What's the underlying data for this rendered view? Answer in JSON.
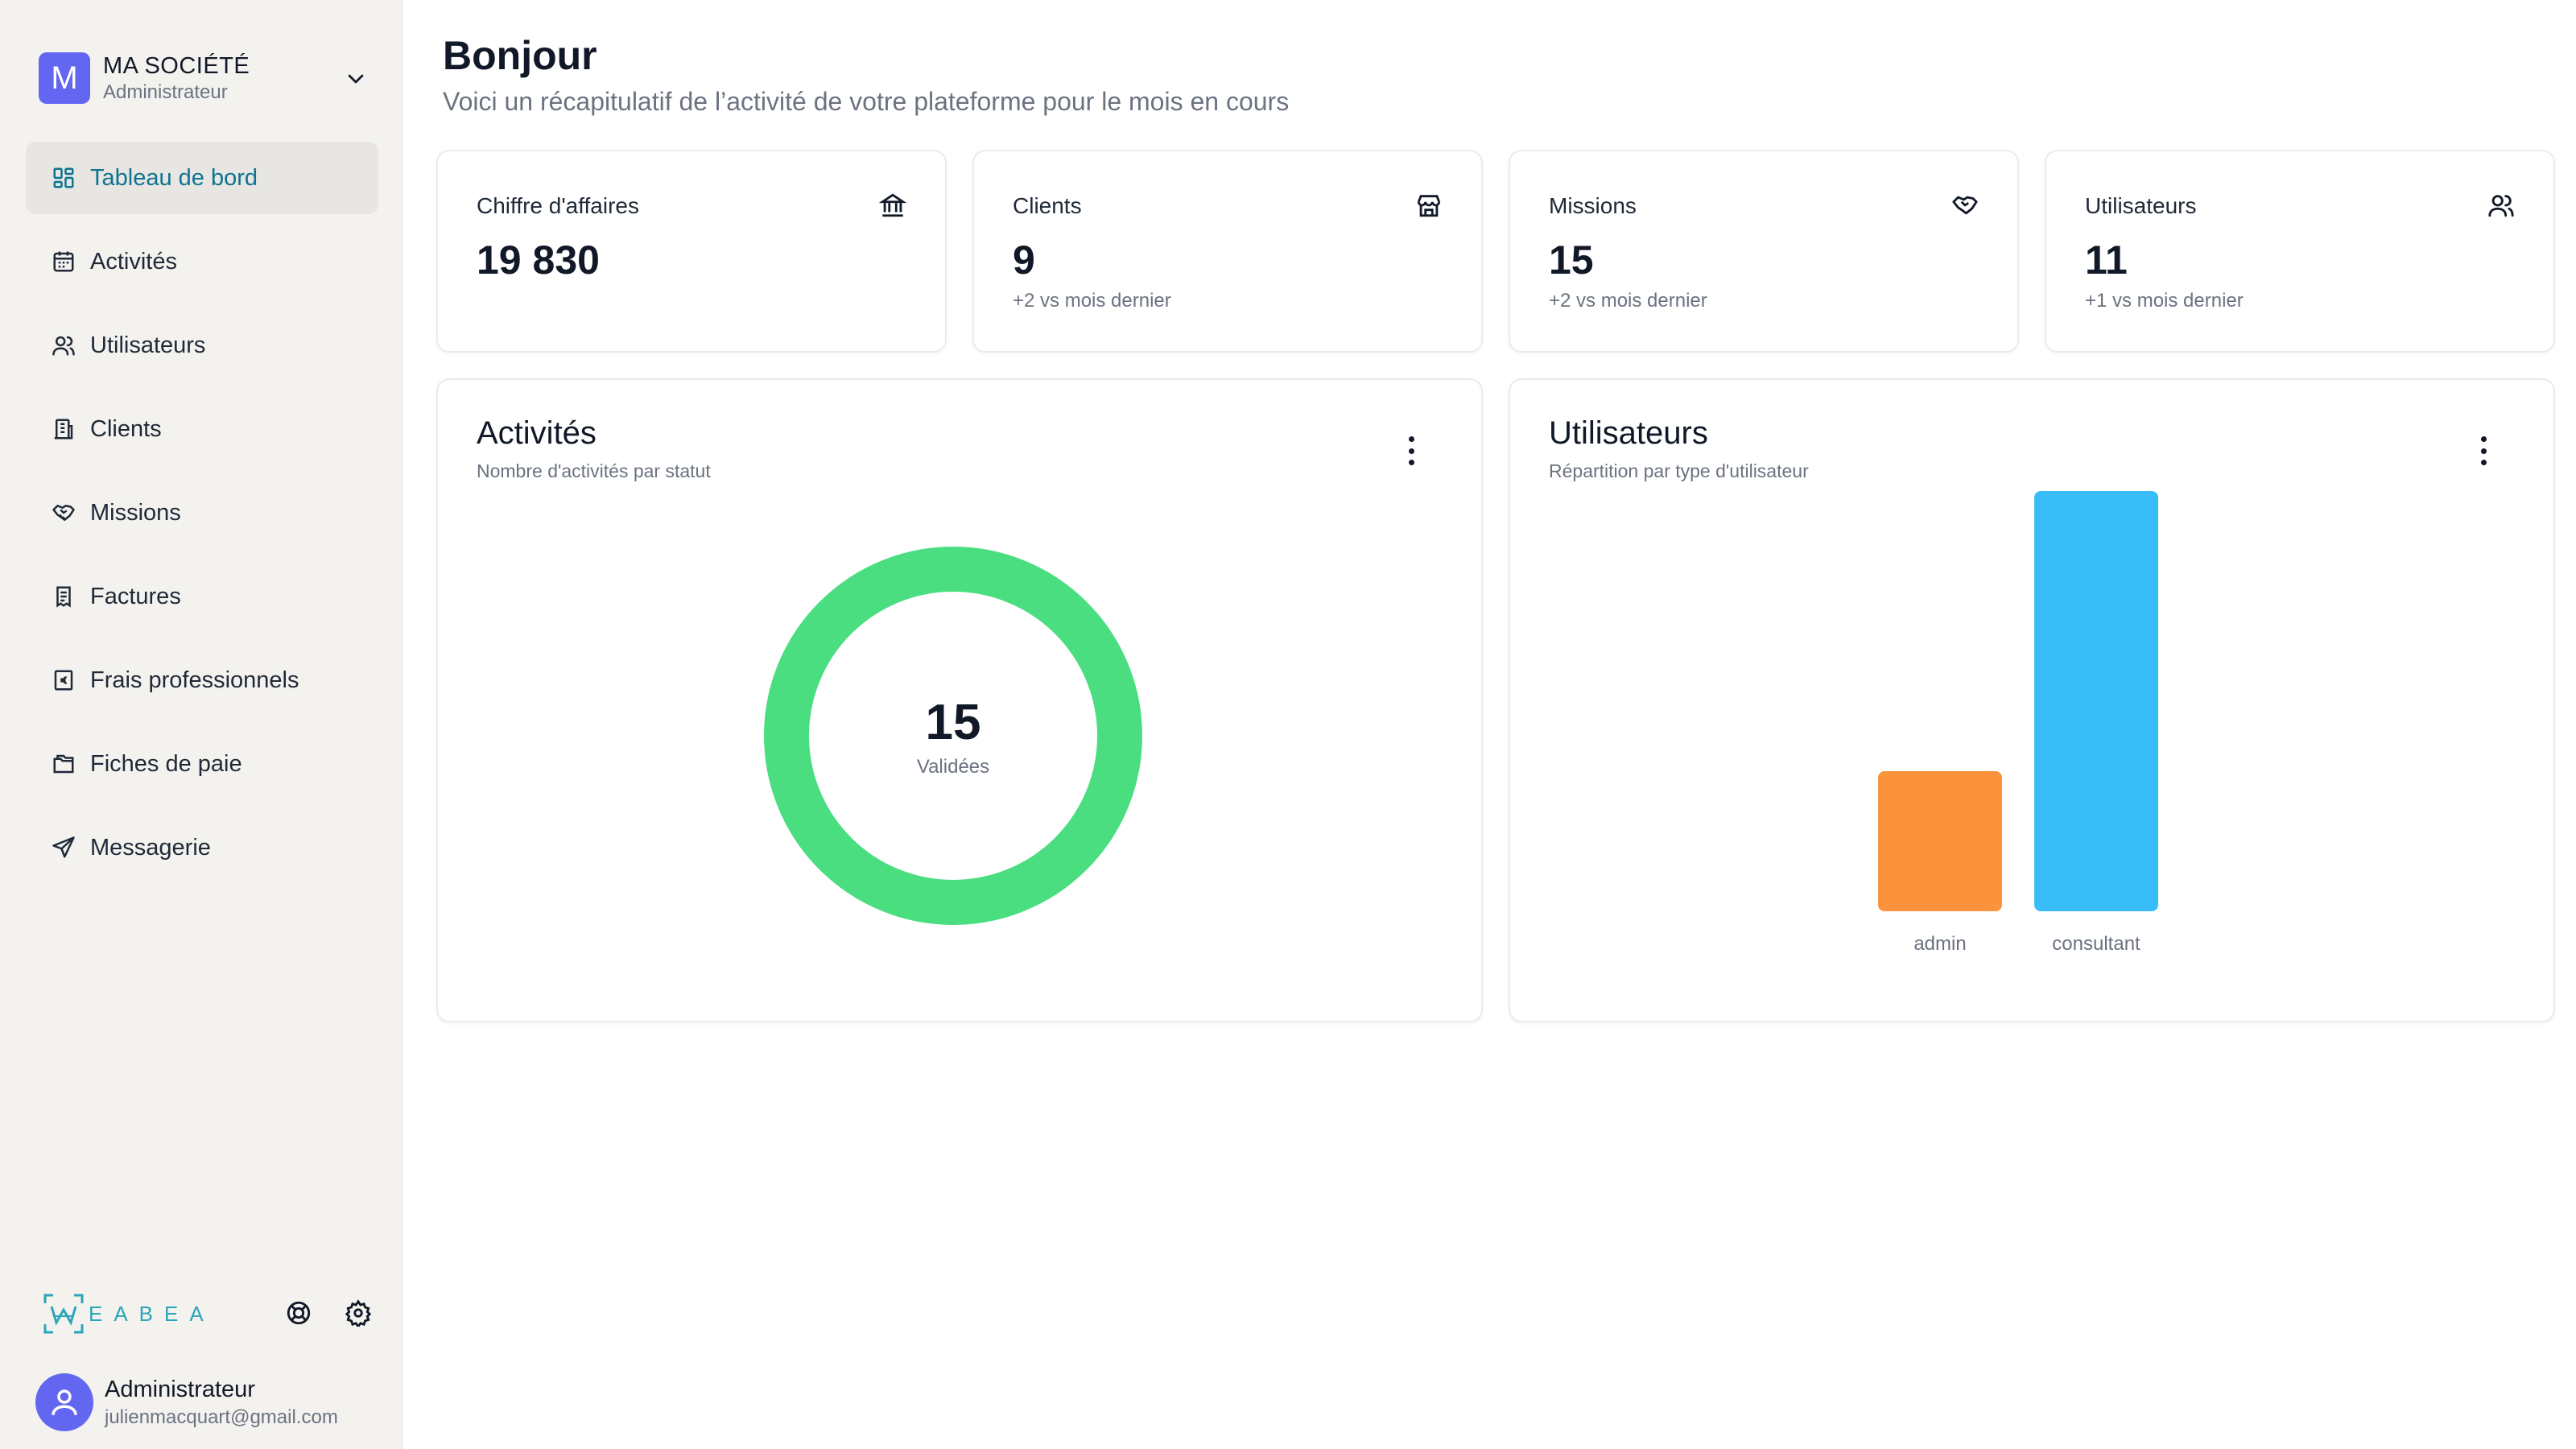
{
  "org": {
    "initial": "M",
    "name": "MA SOCIÉTÉ",
    "role": "Administrateur"
  },
  "nav": [
    {
      "label": "Tableau de bord",
      "icon": "dashboard-icon",
      "active": true
    },
    {
      "label": "Activités",
      "icon": "calendar-icon"
    },
    {
      "label": "Utilisateurs",
      "icon": "users-icon"
    },
    {
      "label": "Clients",
      "icon": "building-icon"
    },
    {
      "label": "Missions",
      "icon": "handshake-icon"
    },
    {
      "label": "Factures",
      "icon": "receipt-icon"
    },
    {
      "label": "Frais professionnels",
      "icon": "euro-receipt-icon"
    },
    {
      "label": "Fiches de paie",
      "icon": "files-icon"
    },
    {
      "label": "Messagerie",
      "icon": "send-icon"
    }
  ],
  "brand": {
    "name": "EABEA",
    "accent": "#2aa6b8"
  },
  "profile": {
    "name": "Administrateur",
    "email": "julienmacquart@gmail.com"
  },
  "header": {
    "greeting": "Bonjour",
    "subtitle": "Voici un récapitulatif de l’activité de votre plateforme pour le mois en cours"
  },
  "stats": [
    {
      "label": "Chiffre d'affaires",
      "value": "19 830",
      "delta": "",
      "icon": "bank-icon"
    },
    {
      "label": "Clients",
      "value": "9",
      "delta": "+2 vs mois dernier",
      "icon": "store-icon"
    },
    {
      "label": "Missions",
      "value": "15",
      "delta": "+2 vs mois dernier",
      "icon": "handshake-icon"
    },
    {
      "label": "Utilisateurs",
      "value": "11",
      "delta": "+1 vs mois dernier",
      "icon": "users-icon"
    }
  ],
  "activities_panel": {
    "title": "Activités",
    "subtitle": "Nombre d'activités par statut"
  },
  "users_panel": {
    "title": "Utilisateurs",
    "subtitle": "Répartition par type d'utilisateur"
  },
  "chart_data": [
    {
      "type": "pie",
      "title": "Activités",
      "subtitle": "Nombre d'activités par statut",
      "categories": [
        "Validées"
      ],
      "values": [
        15
      ],
      "colors": [
        "#4ade80"
      ],
      "center_value": "15",
      "center_label": "Validées"
    },
    {
      "type": "bar",
      "title": "Utilisateurs",
      "subtitle": "Répartition par type d'utilisateur",
      "categories": [
        "admin",
        "consultant"
      ],
      "values": [
        3,
        9
      ],
      "colors": [
        "#fb923c",
        "#38bdf8"
      ],
      "grid": false
    }
  ]
}
